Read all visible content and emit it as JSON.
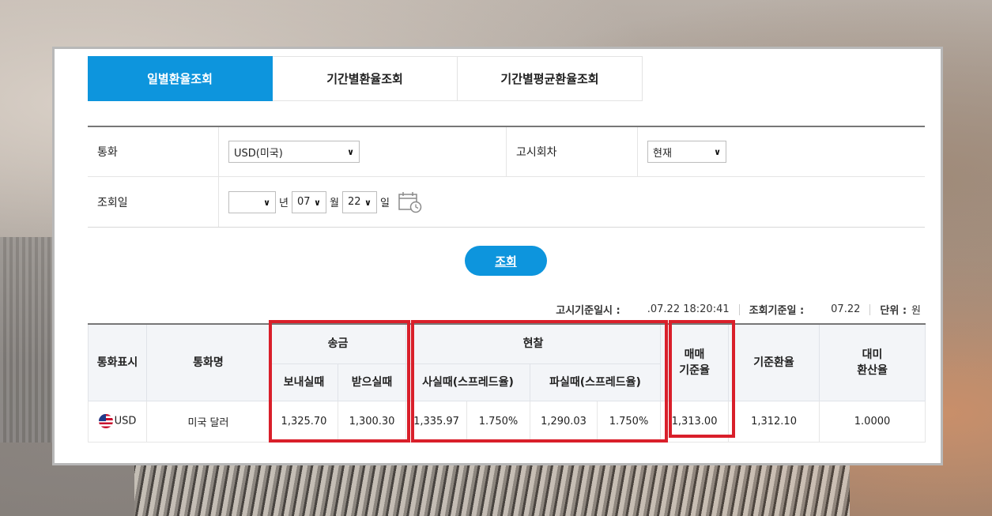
{
  "tabs": [
    {
      "label": "일별환율조회",
      "active": true
    },
    {
      "label": "기간별환율조회",
      "active": false
    },
    {
      "label": "기간별평균환율조회",
      "active": false
    }
  ],
  "form": {
    "currency_label": "통화",
    "currency_value": "USD(미국)",
    "round_label": "고시회차",
    "round_value": "현재",
    "date_label": "조회일",
    "year_value": "",
    "year_unit": "년",
    "month_value": "07",
    "month_unit": "월",
    "day_value": "22",
    "day_unit": "일"
  },
  "search_button": "조회",
  "meta": {
    "notice_label": "고시기준일시 :",
    "notice_value": ".07.22 18:20:41",
    "query_label": "조회기준일 :",
    "query_value": "07.22",
    "unit_label": "단위 :",
    "unit_value": "원"
  },
  "table": {
    "headers": {
      "code": "통화표시",
      "name": "통화명",
      "remit": "송금",
      "remit_send": "보내실때",
      "remit_receive": "받으실때",
      "cash": "현찰",
      "cash_buy": "사실때(스프레드율)",
      "cash_sell": "파실때(스프레드율)",
      "trade_base": "매매\n기준율",
      "base": "기준환율",
      "usd_conv": "대미\n환산율"
    },
    "rows": [
      {
        "code": "USD",
        "name": "미국 달러",
        "remit_send": "1,325.70",
        "remit_receive": "1,300.30",
        "cash_buy": "1,335.97",
        "cash_buy_spread": "1.750%",
        "cash_sell": "1,290.03",
        "cash_sell_spread": "1.750%",
        "trade_base": "1,313.00",
        "base": "1,312.10",
        "usd_conv": "1.0000"
      }
    ]
  },
  "colors": {
    "accent": "#0d95dd",
    "highlight": "#d91f2a"
  }
}
